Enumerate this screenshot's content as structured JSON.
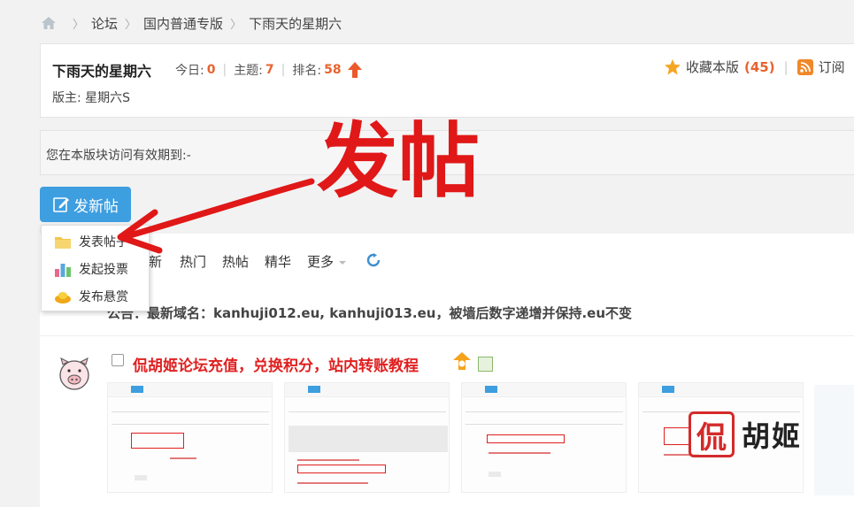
{
  "breadcrumb": {
    "items": [
      "论坛",
      "国内普通专版",
      "下雨天的星期六"
    ]
  },
  "forum": {
    "title": "下雨天的星期六",
    "today_label": "今日:",
    "today_value": "0",
    "topics_label": "主题:",
    "topics_value": "7",
    "rank_label": "排名:",
    "rank_value": "58",
    "moderator": "版主: 星期六S",
    "favorite_label": "收藏本版",
    "favorite_count": "(45)",
    "subscribe_label": "订阅"
  },
  "notice": {
    "text": "您在本版块访问有效期到:-"
  },
  "new_post_button": {
    "label": "发新帖"
  },
  "dropdown": {
    "items": [
      "发表帖子",
      "发起投票",
      "发布悬赏"
    ]
  },
  "tabs": {
    "items": [
      "新",
      "热门",
      "热帖",
      "精华",
      "更多"
    ]
  },
  "announcement": {
    "text": "公告：最新域名：kanhuji012.eu, kanhuji013.eu，被墙后数字递增并保持.eu不变"
  },
  "thread": {
    "title": "侃胡姬论坛充值，兑换积分，站内转账教程"
  },
  "watermark": {
    "logo_char": "侃",
    "text": "胡姬"
  },
  "annotation": {
    "text": "发帖"
  },
  "colors": {
    "accent": "#3d9ee0",
    "highlight": "#e8632f",
    "annotation_red": "#e01818"
  }
}
